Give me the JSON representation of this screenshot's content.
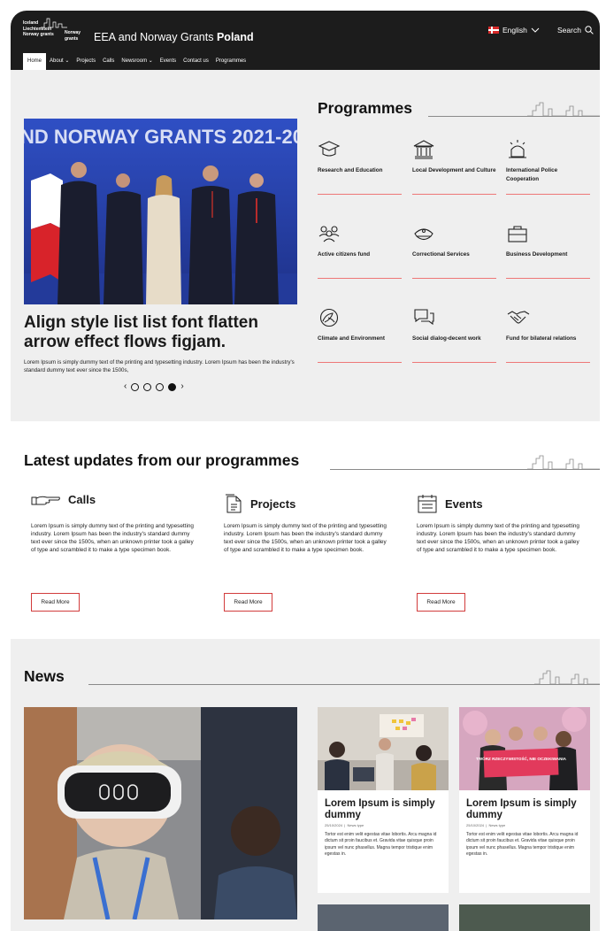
{
  "header": {
    "logo_left": [
      "Iceland",
      "Liechtenstein",
      "Norway grants"
    ],
    "logo_right": [
      "Norway",
      "grants"
    ],
    "site_title_prefix": "EEA and Norway Grants",
    "site_title_bold": "Poland",
    "language": "English",
    "search_label": "Search"
  },
  "nav": [
    {
      "label": "Home",
      "active": true
    },
    {
      "label": "About ⌄"
    },
    {
      "label": "Projects"
    },
    {
      "label": "Calls"
    },
    {
      "label": "Newsroom ⌄"
    },
    {
      "label": "Events"
    },
    {
      "label": "Contact us"
    },
    {
      "label": "Programmes"
    }
  ],
  "hero": {
    "banner_text": "ND NORWAY GRANTS 2021-20",
    "title": "Align style list list font flatten arrow effect flows figjam.",
    "body": "Lorem Ipsum is simply dummy text of the printing and typesetting industry. Lorem Ipsum has been the industry's standard dummy text ever since the 1500s,",
    "slides": 4,
    "active_slide": 4
  },
  "programmes": {
    "title": "Programmes",
    "items": [
      {
        "label": "Research and Education",
        "icon": "graduation-cap-icon"
      },
      {
        "label": "Local Development and Culture",
        "icon": "museum-icon"
      },
      {
        "label": "International Police Cooperation",
        "icon": "police-light-icon"
      },
      {
        "label": "Active citizens fund",
        "icon": "people-icon"
      },
      {
        "label": "Correctional Services",
        "icon": "officer-cap-icon"
      },
      {
        "label": "Business Development",
        "icon": "briefcase-icon"
      },
      {
        "label": "Climate and Environment",
        "icon": "globe-leaf-icon"
      },
      {
        "label": "Social dialog-decent work",
        "icon": "chat-icon"
      },
      {
        "label": "Fund for bilateral relations",
        "icon": "handshake-icon"
      }
    ]
  },
  "updates": {
    "title": "Latest updates from our programmes",
    "columns": [
      {
        "title": "Calls",
        "icon": "pointing-hand-icon",
        "body": "Lorem Ipsum is simply dummy text of the printing and typesetting industry. Lorem Ipsum has been the industry's standard dummy text ever since the 1500s, when an unknown printer took a galley of type and scrambled it to make a type specimen book.",
        "button": "Read More"
      },
      {
        "title": "Projects",
        "icon": "document-icon",
        "body": "Lorem Ipsum is simply dummy text of the printing and typesetting industry. Lorem Ipsum has been the industry's standard dummy text ever since the 1500s, when an unknown printer took a galley of type and scrambled it to make a type specimen book.",
        "button": "Read More"
      },
      {
        "title": "Events",
        "icon": "calendar-icon",
        "body": "Lorem Ipsum is simply dummy text of the printing and typesetting industry. Lorem Ipsum has been the industry's standard dummy text ever since the 1500s, when an unknown printer took a galley of type and scrambled it to make a type specimen book.",
        "button": "Read More"
      }
    ]
  },
  "news": {
    "title": "News",
    "cards": [
      {
        "title": "Lorem Ipsum is simply dummy",
        "date": "25/10/2024",
        "type": "News type",
        "body": "Tortor est enim velit egestas vitae lobortis. Arcu magna id dictum sit proin faucibus et. Gravida vitae quisque proin ipsum vel nunc phasellus. Magna tempor tristique enim egestas in."
      },
      {
        "title": "Lorem Ipsum is simply dummy",
        "date": "25/10/2024",
        "type": "News type",
        "body": "Tortor est enim velit egestas vitae lobortis. Arcu magna id dictum sit proin faucibus et. Gravida vitae quisque proin ipsum vel nunc phasellus. Magna tempor tristique enim egestas in.",
        "sign_text": "TWÓRZ RZECZYWISTOŚĆ, NIE OCZEKIWANIA"
      }
    ]
  },
  "colors": {
    "header_bg": "#1c1c1c",
    "page_bg": "#efefef",
    "accent_red": "#d23c3c",
    "divider_pink": "#e77777"
  }
}
